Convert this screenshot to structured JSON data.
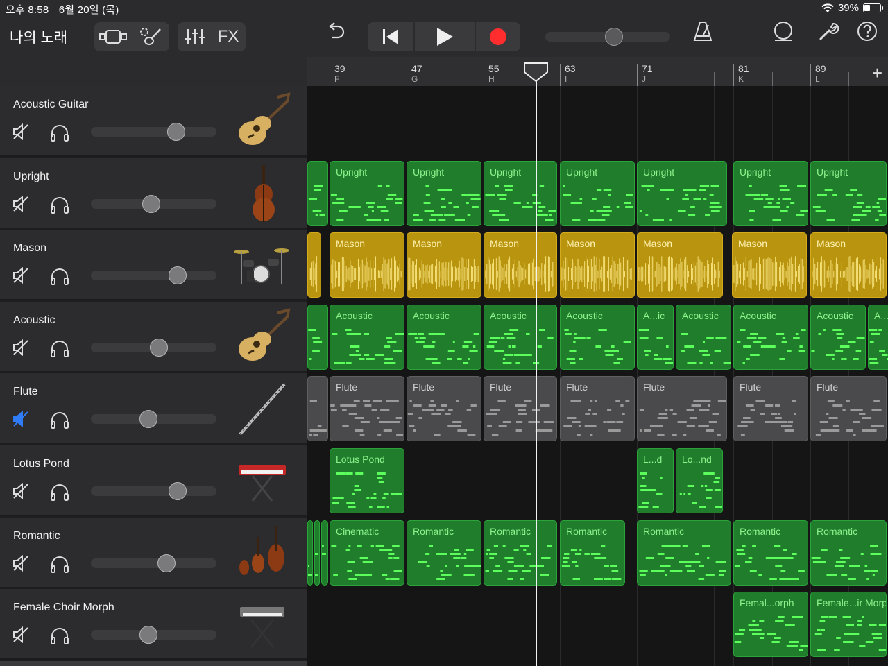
{
  "status": {
    "time": "오후 8:58",
    "date": "6월 20일 (목)",
    "battery": "39%",
    "battery_level": 0.39
  },
  "toolbar": {
    "song_title": "나의 노래",
    "fx_label": "FX",
    "master_volume": 0.55
  },
  "ruler": {
    "bars": [
      {
        "num": "39",
        "section": "F"
      },
      {
        "num": "47",
        "section": "G"
      },
      {
        "num": "55",
        "section": "H"
      },
      {
        "num": "63",
        "section": "I"
      },
      {
        "num": "71",
        "section": "J"
      },
      {
        "num": "81",
        "section": "K"
      },
      {
        "num": "89",
        "section": "L"
      }
    ],
    "add_label": "+"
  },
  "tracks": [
    {
      "name": "Acoustic Guitar",
      "instrument": "acoustic-guitar",
      "muted": false,
      "volume": 0.68
    },
    {
      "name": "Upright",
      "instrument": "upright-bass",
      "muted": false,
      "volume": 0.48
    },
    {
      "name": "Mason",
      "instrument": "drum-kit",
      "muted": false,
      "volume": 0.69
    },
    {
      "name": "Acoustic",
      "instrument": "acoustic-guitar",
      "muted": false,
      "volume": 0.54
    },
    {
      "name": "Flute",
      "instrument": "flute",
      "muted": true,
      "volume": 0.46
    },
    {
      "name": "Lotus Pond",
      "instrument": "synth-keyboard",
      "muted": false,
      "volume": 0.69
    },
    {
      "name": "Romantic",
      "instrument": "string-ensemble",
      "muted": false,
      "volume": 0.6
    },
    {
      "name": "Female Choir Morph",
      "instrument": "keyboard-stand",
      "muted": false,
      "volume": 0.46
    }
  ],
  "regions": [
    [],
    [
      "Upright",
      "Upright",
      "Upright",
      "Upright",
      "Upright",
      "Upright",
      "Upright"
    ],
    [
      "Mason",
      "Mason",
      "Mason",
      "Mason",
      "Mason",
      "Mason",
      "Mason"
    ],
    [
      "Acoustic",
      "Acoustic",
      "Acoustic",
      "Acoustic",
      "A...ic",
      "Acoustic",
      "Acoustic",
      "Acoustic",
      "A..."
    ],
    [
      "Flute",
      "Flute",
      "Flute",
      "Flute",
      "Flute",
      "Flute",
      "Flute"
    ],
    [
      "Lotus Pond",
      "L...d",
      "Lo...nd"
    ],
    [
      "Cinematic",
      "Romantic",
      "Romantic",
      "Romantic",
      "Romantic",
      "Romantic",
      "Romantic"
    ],
    [
      "Femal...orph",
      "Female...ir Morph"
    ]
  ],
  "colors": {
    "midi": "#1f7d2b",
    "audio": "#b8940f",
    "muted": "#4a4a4c",
    "record": "#ff2d2d",
    "mute_active": "#2f7cf6"
  }
}
